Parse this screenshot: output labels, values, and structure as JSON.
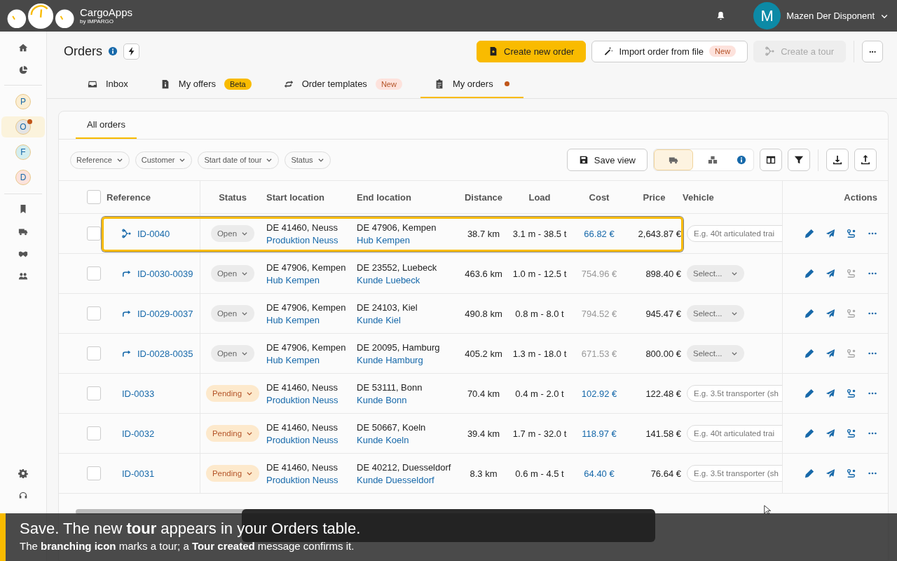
{
  "app": {
    "name": "CargoApps",
    "byline": "by IMPARGO"
  },
  "user": {
    "initial": "M",
    "name": "Mazen Der Disponent"
  },
  "sidebar": {
    "apps": [
      {
        "letter": "P",
        "color": "#fbeed3",
        "selected": false,
        "dot": false
      },
      {
        "letter": "O",
        "color": "#e4e4e4",
        "selected": true,
        "dot": true
      },
      {
        "letter": "F",
        "color": "#d3eef0",
        "selected": false,
        "dot": false
      },
      {
        "letter": "D",
        "color": "#fde2dc",
        "selected": false,
        "dot": false
      }
    ]
  },
  "page": {
    "title": "Orders"
  },
  "actions": [
    {
      "kind": "primary",
      "label": "Create new order",
      "disabled": false
    },
    {
      "kind": "import",
      "label": "Import order from file",
      "badge": "New",
      "disabled": false
    },
    {
      "kind": "tour",
      "label": "Create a tour",
      "disabled": true
    },
    {
      "kind": "more",
      "label": "···",
      "disabled": false
    }
  ],
  "tabs": [
    {
      "label": "Inbox",
      "selected": false,
      "dot": false
    },
    {
      "label": "My offers",
      "badge": {
        "kind": "beta",
        "text": "Beta"
      },
      "selected": false,
      "dot": false
    },
    {
      "label": "Order templates",
      "badge": {
        "kind": "new",
        "text": "New"
      },
      "selected": false,
      "dot": false
    },
    {
      "label": "My orders",
      "selected": true,
      "dot": true
    }
  ],
  "subtabs": [
    {
      "label": "All orders",
      "selected": true
    }
  ],
  "filters": [
    "Reference",
    "Customer",
    "Start date of tour",
    "Status"
  ],
  "toolbar": {
    "save_label": "Save view",
    "views": [
      {
        "selected": true
      },
      {
        "selected": false
      }
    ]
  },
  "table": {
    "all_checked": false,
    "columns": [
      "Reference",
      "Status",
      "Start location",
      "End location",
      "Distance",
      "Load",
      "Cost",
      "Price",
      "Vehicle",
      "Actions"
    ],
    "rows": [
      {
        "checked": false,
        "highlighted": true,
        "reference": {
          "kind": "tour",
          "text": "ID-0040"
        },
        "status": {
          "kind": "open",
          "text": "Open"
        },
        "start": "DE 41460, Neuss",
        "start_site": "Produktion Neuss",
        "end": "DE 47906, Kempen",
        "end_site": "Hub Kempen",
        "distance": "38.7 km",
        "load": "3.1 m - 38.5 t",
        "cost": "66.82 €",
        "cost_muted": false,
        "price": "2,643.87 €",
        "vehicle": {
          "kind": "input",
          "placeholder": "E.g. 40t articulated trai"
        },
        "assign_disabled": false
      },
      {
        "checked": false,
        "highlighted": false,
        "reference": {
          "kind": "forward",
          "text": "ID-0030-0039"
        },
        "status": {
          "kind": "open",
          "text": "Open"
        },
        "start": "DE 47906, Kempen",
        "start_site": "Hub Kempen",
        "end": "DE 23552, Luebeck",
        "end_site": "Kunde Luebeck",
        "distance": "463.6 km",
        "load": "1.0 m - 12.5 t",
        "cost": "754.96 €",
        "cost_muted": true,
        "price": "898.40 €",
        "vehicle": {
          "kind": "select",
          "text": "Select..."
        },
        "assign_disabled": true
      },
      {
        "checked": false,
        "highlighted": false,
        "reference": {
          "kind": "forward",
          "text": "ID-0029-0037"
        },
        "status": {
          "kind": "open",
          "text": "Open"
        },
        "start": "DE 47906, Kempen",
        "start_site": "Hub Kempen",
        "end": "DE 24103, Kiel",
        "end_site": "Kunde Kiel",
        "distance": "490.8 km",
        "load": "0.8 m - 8.0 t",
        "cost": "794.52 €",
        "cost_muted": true,
        "price": "945.47 €",
        "vehicle": {
          "kind": "select",
          "text": "Select..."
        },
        "assign_disabled": true
      },
      {
        "checked": false,
        "highlighted": false,
        "reference": {
          "kind": "forward",
          "text": "ID-0028-0035"
        },
        "status": {
          "kind": "open",
          "text": "Open"
        },
        "start": "DE 47906, Kempen",
        "start_site": "Hub Kempen",
        "end": "DE 20095, Hamburg",
        "end_site": "Kunde Hamburg",
        "distance": "405.2 km",
        "load": "1.3 m - 18.0 t",
        "cost": "671.53 €",
        "cost_muted": true,
        "price": "800.00 €",
        "vehicle": {
          "kind": "select",
          "text": "Select..."
        },
        "assign_disabled": true
      },
      {
        "checked": false,
        "highlighted": false,
        "reference": {
          "kind": "plain",
          "text": "ID-0033"
        },
        "status": {
          "kind": "pending",
          "text": "Pending"
        },
        "start": "DE 41460, Neuss",
        "start_site": "Produktion Neuss",
        "end": "DE 53111, Bonn",
        "end_site": "Kunde Bonn",
        "distance": "70.4 km",
        "load": "0.4 m - 2.0 t",
        "cost": "102.92 €",
        "cost_muted": false,
        "price": "122.48 €",
        "vehicle": {
          "kind": "input",
          "placeholder": "E.g. 3.5t transporter (sh"
        },
        "assign_disabled": false
      },
      {
        "checked": false,
        "highlighted": false,
        "reference": {
          "kind": "plain",
          "text": "ID-0032"
        },
        "status": {
          "kind": "pending",
          "text": "Pending"
        },
        "start": "DE 41460, Neuss",
        "start_site": "Produktion Neuss",
        "end": "DE 50667, Koeln",
        "end_site": "Kunde Koeln",
        "distance": "39.4 km",
        "load": "1.7 m - 32.0 t",
        "cost": "118.97 €",
        "cost_muted": false,
        "price": "141.58 €",
        "vehicle": {
          "kind": "input",
          "placeholder": "E.g. 40t articulated trai"
        },
        "assign_disabled": false
      },
      {
        "checked": false,
        "highlighted": false,
        "reference": {
          "kind": "plain",
          "text": "ID-0031"
        },
        "status": {
          "kind": "pending",
          "text": "Pending"
        },
        "start": "DE 41460, Neuss",
        "start_site": "Produktion Neuss",
        "end": "DE 40212, Duesseldorf",
        "end_site": "Kunde Duesseldorf",
        "distance": "8.3 km",
        "load": "0.6 m - 4.5 t",
        "cost": "64.40 €",
        "cost_muted": false,
        "price": "76.64 €",
        "vehicle": {
          "kind": "input",
          "placeholder": "E.g. 3.5t transporter (sh"
        },
        "assign_disabled": false
      }
    ]
  },
  "caption": {
    "headline": "Save. The new **tour** appears in your Orders table.",
    "detail": "The **branching icon** marks a tour; a **Tour created** message confirms it."
  }
}
